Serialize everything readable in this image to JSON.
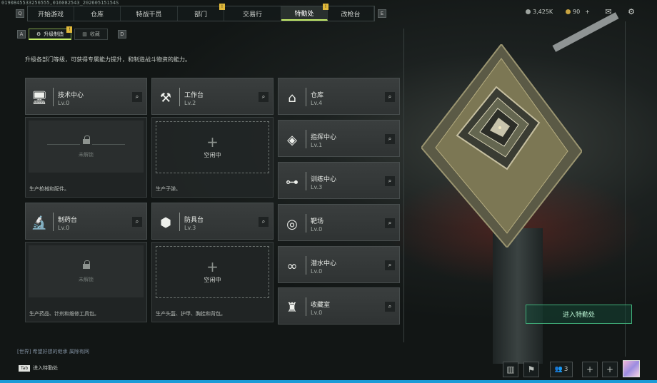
{
  "build_id": "0190845533256555,016082543_20260515154S",
  "nav": {
    "left_key": "Q",
    "right_key": "E",
    "tabs": [
      {
        "label": "开始游戏",
        "badge": ""
      },
      {
        "label": "仓库",
        "badge": ""
      },
      {
        "label": "特战干员",
        "badge": ""
      },
      {
        "label": "部门",
        "badge": "!"
      },
      {
        "label": "交易行",
        "badge": ""
      },
      {
        "label": "特勤处",
        "badge": "!",
        "active": true
      },
      {
        "label": "改枪台",
        "badge": ""
      }
    ]
  },
  "currency": {
    "silver": "3,425K",
    "gold": "90",
    "add": "+"
  },
  "icons": {
    "mail": "mail-icon",
    "settings": "gear-icon"
  },
  "subtabs": {
    "left_key": "A",
    "right_key": "D",
    "items": [
      {
        "label": "升级制造",
        "active": true,
        "badge": "!"
      },
      {
        "label": "收藏",
        "active": false,
        "badge": ""
      }
    ]
  },
  "description": "升级各部门等级，可获得专属能力提升，和制造战斗物资的能力。",
  "columns": [
    {
      "card": {
        "name": "技术中心",
        "level": "Lv.0",
        "icon": "monitor-icon"
      },
      "panel": {
        "state": "locked",
        "text": "未解锁",
        "desc": "生产枪械和配件。"
      },
      "card2": {
        "name": "制药台",
        "level": "Lv.0",
        "icon": "microscope-icon"
      },
      "panel2": {
        "state": "locked",
        "text": "未解锁",
        "desc": "生产药品、针剂和维修工具包。"
      }
    },
    {
      "card": {
        "name": "工作台",
        "level": "Lv.2",
        "icon": "tools-icon"
      },
      "panel": {
        "state": "idle",
        "text": "空闲中",
        "desc": "生产子弹。"
      },
      "card2": {
        "name": "防具台",
        "level": "Lv.3",
        "icon": "armor-icon"
      },
      "panel2": {
        "state": "idle",
        "text": "空闲中",
        "desc": "生产头盔、护甲、胸挂和背包。"
      }
    }
  ],
  "right_cards": [
    {
      "name": "仓库",
      "level": "Lv.4",
      "icon": "warehouse-icon"
    },
    {
      "name": "指挥中心",
      "level": "Lv.1",
      "icon": "command-icon"
    },
    {
      "name": "训练中心",
      "level": "Lv.3",
      "icon": "dumbbell-icon"
    },
    {
      "name": "靶场",
      "level": "Lv.0",
      "icon": "target-icon"
    },
    {
      "name": "潜水中心",
      "level": "Lv.0",
      "icon": "diving-mask-icon"
    },
    {
      "name": "收藏室",
      "level": "Lv.0",
      "icon": "trophy-icon"
    }
  ],
  "enter_button": "进入特勤处",
  "chat": "[世界] 希望好想的继承 属除有网",
  "tab_hint": {
    "key": "Tab",
    "label": "进入特勤处"
  },
  "bottom_icons": [
    "chart-icon",
    "flag-icon",
    "friends-icon",
    "plus-icon",
    "plus-icon"
  ],
  "friends_count": "3",
  "colors": {
    "accent": "#c7f06a",
    "enter": "#3fae79",
    "badge": "#e0b83a",
    "bottom_bar": "#1b9bd7"
  }
}
